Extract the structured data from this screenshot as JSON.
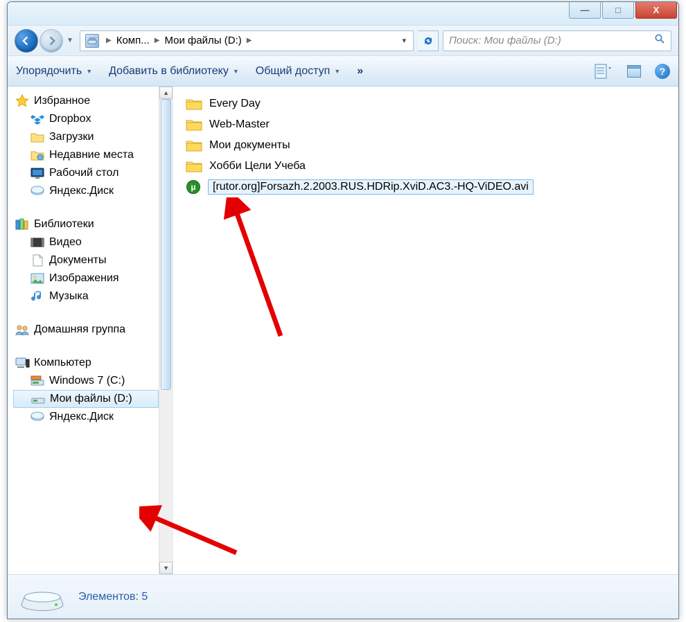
{
  "title_buttons": {
    "min": "—",
    "max": "□",
    "close": "X"
  },
  "breadcrumb": {
    "seg1": "Комп...",
    "seg2": "Мои файлы (D:)"
  },
  "search": {
    "placeholder": "Поиск: Мои файлы (D:)"
  },
  "toolbar": {
    "organize": "Упорядочить",
    "add_library": "Добавить в библиотеку",
    "share": "Общий доступ",
    "more": "»"
  },
  "sidebar": {
    "favorites": {
      "head": "Избранное",
      "items": [
        "Dropbox",
        "Загрузки",
        "Недавние места",
        "Рабочий стол",
        "Яндекс.Диск"
      ]
    },
    "libraries": {
      "head": "Библиотеки",
      "items": [
        "Видео",
        "Документы",
        "Изображения",
        "Музыка"
      ]
    },
    "homegroup": {
      "head": "Домашняя группа"
    },
    "computer": {
      "head": "Компьютер",
      "items": [
        "Windows 7 (C:)",
        "Мои файлы (D:)",
        "Яндекс.Диск"
      ]
    }
  },
  "files": [
    {
      "kind": "folder",
      "name": "Every Day"
    },
    {
      "kind": "folder",
      "name": "Web-Master"
    },
    {
      "kind": "folder",
      "name": "Мои документы"
    },
    {
      "kind": "folder",
      "name": "Хобби Цели Учеба"
    },
    {
      "kind": "video",
      "name": "[rutor.org]Forsazh.2.2003.RUS.HDRip.XviD.AC3.-HQ-ViDEO.avi"
    }
  ],
  "status": {
    "items": "Элементов: 5"
  }
}
